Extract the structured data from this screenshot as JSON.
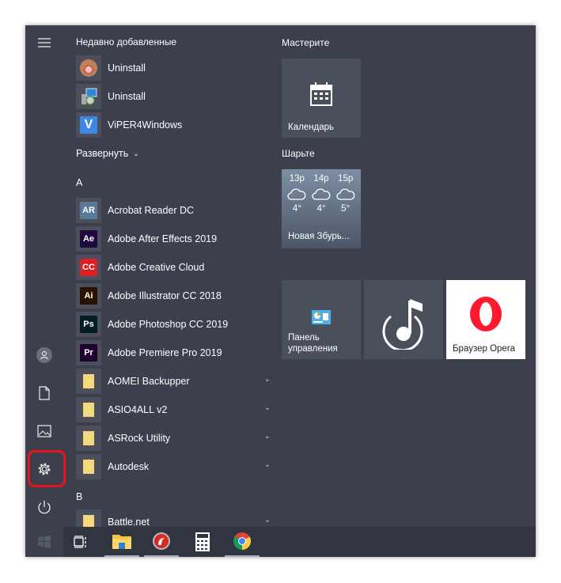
{
  "rail": {
    "icons": [
      "hamburger-icon",
      "user-icon",
      "document-icon",
      "pictures-icon",
      "settings-icon",
      "power-icon",
      "windows-icon"
    ]
  },
  "recent": {
    "header": "Недавно добавленные",
    "items": [
      {
        "label": "Uninstall"
      },
      {
        "label": "Uninstall"
      },
      {
        "label": "ViPER4Windows"
      }
    ]
  },
  "expand_label": "Развернуть",
  "letter_a": "A",
  "letter_b": "B",
  "apps": [
    {
      "label": "Acrobat Reader DC",
      "icon": "AR",
      "color": "#5a7a9a"
    },
    {
      "label": "Adobe After Effects 2019",
      "icon": "Ae",
      "color": "#1f0740"
    },
    {
      "label": "Adobe Creative Cloud",
      "icon": "CC",
      "color": "#da1f26"
    },
    {
      "label": "Adobe Illustrator CC 2018",
      "icon": "Ai",
      "color": "#2b1200"
    },
    {
      "label": "Adobe Photoshop CC 2019",
      "icon": "Ps",
      "color": "#001d26"
    },
    {
      "label": "Adobe Premiere Pro 2019",
      "icon": "Pr",
      "color": "#1e0230"
    },
    {
      "label": "AOMEI Backupper",
      "folder": true
    },
    {
      "label": "ASIO4ALL v2",
      "folder": true
    },
    {
      "label": "ASRock Utility",
      "folder": true
    },
    {
      "label": "Autodesk",
      "folder": true
    }
  ],
  "battle": {
    "label": "Battle.net"
  },
  "tiles": {
    "group1": "Мастерите",
    "calendar": "Календарь",
    "group2": "Шарьте",
    "weather": {
      "hours": [
        "13р",
        "14р",
        "15р"
      ],
      "temps": [
        "4°",
        "4°",
        "5°"
      ],
      "location": "Новая Збурь..."
    },
    "control_panel": "Панель управления",
    "opera": "Браузер Opera"
  },
  "taskbar": {
    "items": [
      "task-view-icon",
      "file-explorer-icon",
      "app-red-icon",
      "calculator-icon",
      "chrome-icon"
    ]
  }
}
